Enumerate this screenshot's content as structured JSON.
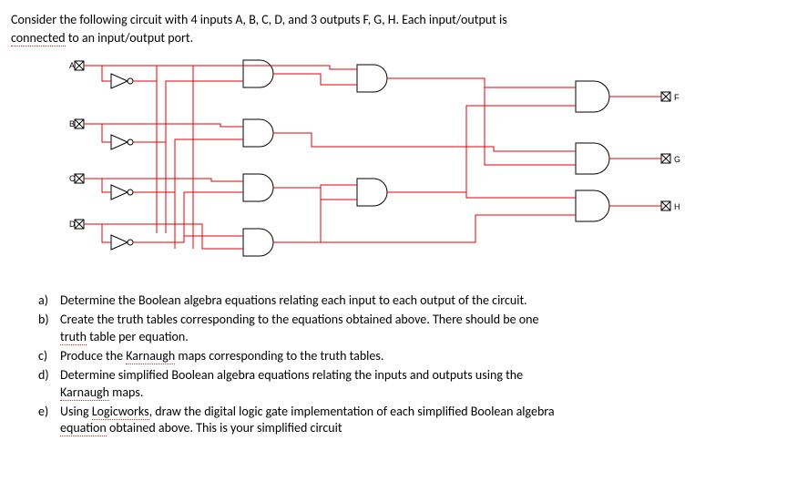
{
  "intro": {
    "line1_a": "Consider the following circuit with 4 inputs A, B, C, D, and 3 outputs F, G, H. Each input/output is",
    "line2_a": "connected",
    "line2_b": " to an input/output port."
  },
  "circuit": {
    "inputs": [
      "A",
      "B",
      "C",
      "D"
    ],
    "outputs": [
      "F",
      "G",
      "H"
    ]
  },
  "questions": {
    "a": {
      "marker": "a)",
      "t1": "Determine the Boolean algebra equations relating each input to each output of the circuit."
    },
    "b": {
      "marker": "b)",
      "t1": "Create the truth tables corresponding to the equations obtained above. There should be one",
      "t2a": "truth",
      "t2b": " table per equation."
    },
    "c": {
      "marker": "c)",
      "t1a": "Produce the ",
      "t1b": "Karnaugh",
      "t1c": " maps corresponding to the truth tables."
    },
    "d": {
      "marker": "d)",
      "t1": "Determine simplified Boolean algebra equations relating the inputs and outputs using the",
      "t2a": "Karnaugh",
      "t2b": " maps."
    },
    "e": {
      "marker": "e)",
      "t1a": "Using ",
      "t1b": "Logicworks",
      "t1c": ", draw the digital logic gate implementation of each simplified Boolean algebra",
      "t2a": "equation",
      "t2b": " obtained above. This is your simplified circuit"
    }
  }
}
